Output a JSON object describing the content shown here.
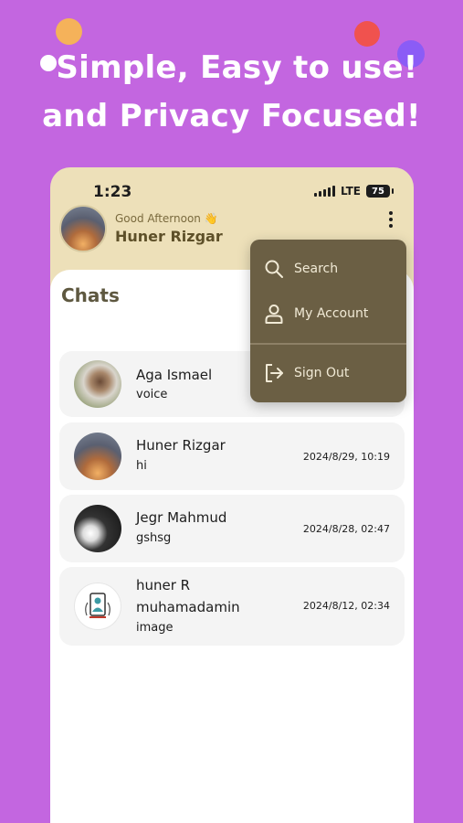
{
  "promo": {
    "headline_line1": "Simple, Easy to use!",
    "headline_line2": "and Privacy Focused!"
  },
  "status_bar": {
    "time": "1:23",
    "network": "LTE",
    "battery": "75"
  },
  "header": {
    "greeting": "Good Afternoon 👋",
    "user_name": "Huner Rizgar"
  },
  "section_title": "Chats",
  "chats": [
    {
      "name": "Aga Ismael",
      "last_message": "voice",
      "timestamp": ""
    },
    {
      "name": "Huner Rizgar",
      "last_message": "hi",
      "timestamp": "2024/8/29, 10:19"
    },
    {
      "name": "Jegr Mahmud",
      "last_message": "gshsg",
      "timestamp": "2024/8/28, 02:47"
    },
    {
      "name_line1": "huner R",
      "name_line2": "muhamadamin",
      "last_message": "image",
      "timestamp": "2024/8/12, 02:34"
    }
  ],
  "menu": {
    "items": [
      {
        "label": "Search",
        "icon": "search-icon"
      },
      {
        "label": "My Account",
        "icon": "person-icon"
      },
      {
        "label": "Sign Out",
        "icon": "sign-out-icon"
      }
    ]
  },
  "colors": {
    "background": "#c366e0",
    "header_bg": "#ede0b9",
    "menu_bg": "#6b5f44",
    "card_bg": "#f4f4f4"
  }
}
